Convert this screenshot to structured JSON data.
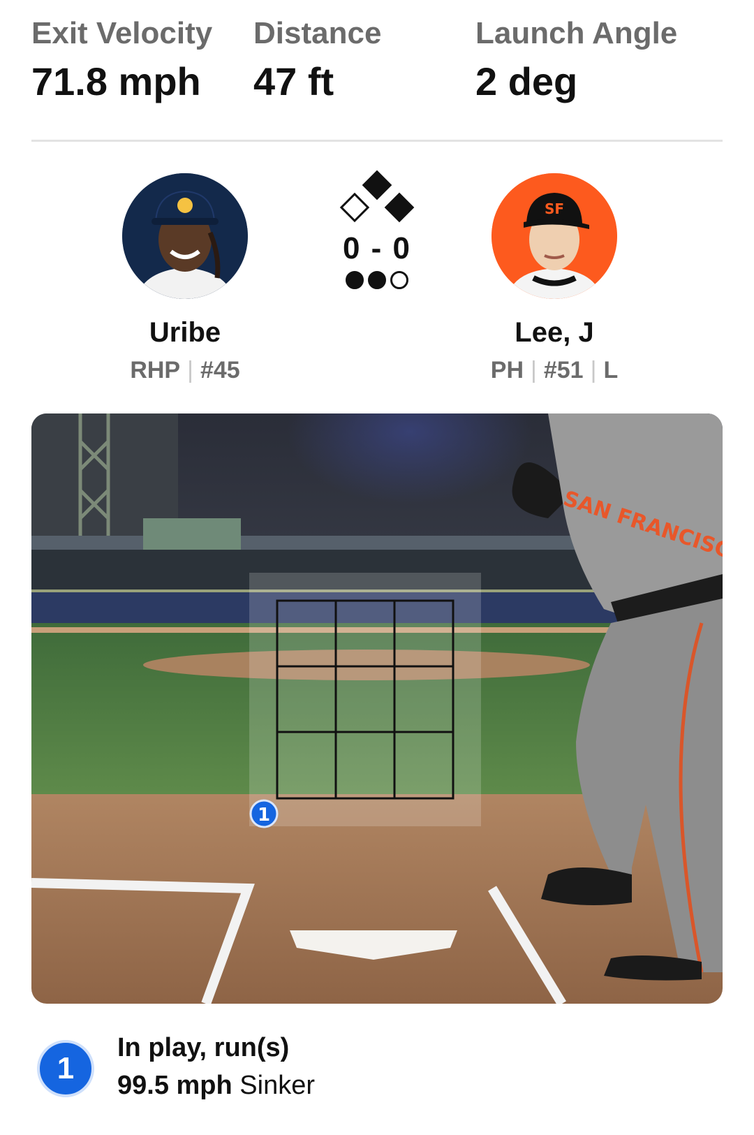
{
  "stats": {
    "exit_velocity": {
      "label": "Exit Velocity",
      "value": "71.8 mph"
    },
    "distance": {
      "label": "Distance",
      "value": "47 ft"
    },
    "launch_angle": {
      "label": "Launch Angle",
      "value": "2 deg"
    }
  },
  "pitcher": {
    "name": "Uribe",
    "position": "RHP",
    "number": "#45",
    "avatar_icon": "pitcher-headshot"
  },
  "batter": {
    "name": "Lee, J",
    "position": "PH",
    "number": "#51",
    "bats": "L",
    "avatar_icon": "batter-headshot"
  },
  "count": {
    "score": "0 - 0",
    "bases": {
      "first": true,
      "second": true,
      "third": false
    },
    "outs": [
      true,
      true,
      false
    ]
  },
  "field": {
    "strike_zone_grid": "3x3",
    "pitch_marker": "1",
    "jersey_text": "SAN FRANCISCO"
  },
  "pitch": {
    "number": "1",
    "result": "In play, run(s)",
    "speed": "99.5 mph",
    "type": "Sinker"
  },
  "colors": {
    "pitch_badge": "#1565e0",
    "pitcher_avatar_bg": "#13294b",
    "batter_avatar_bg": "#fd5a1e"
  }
}
